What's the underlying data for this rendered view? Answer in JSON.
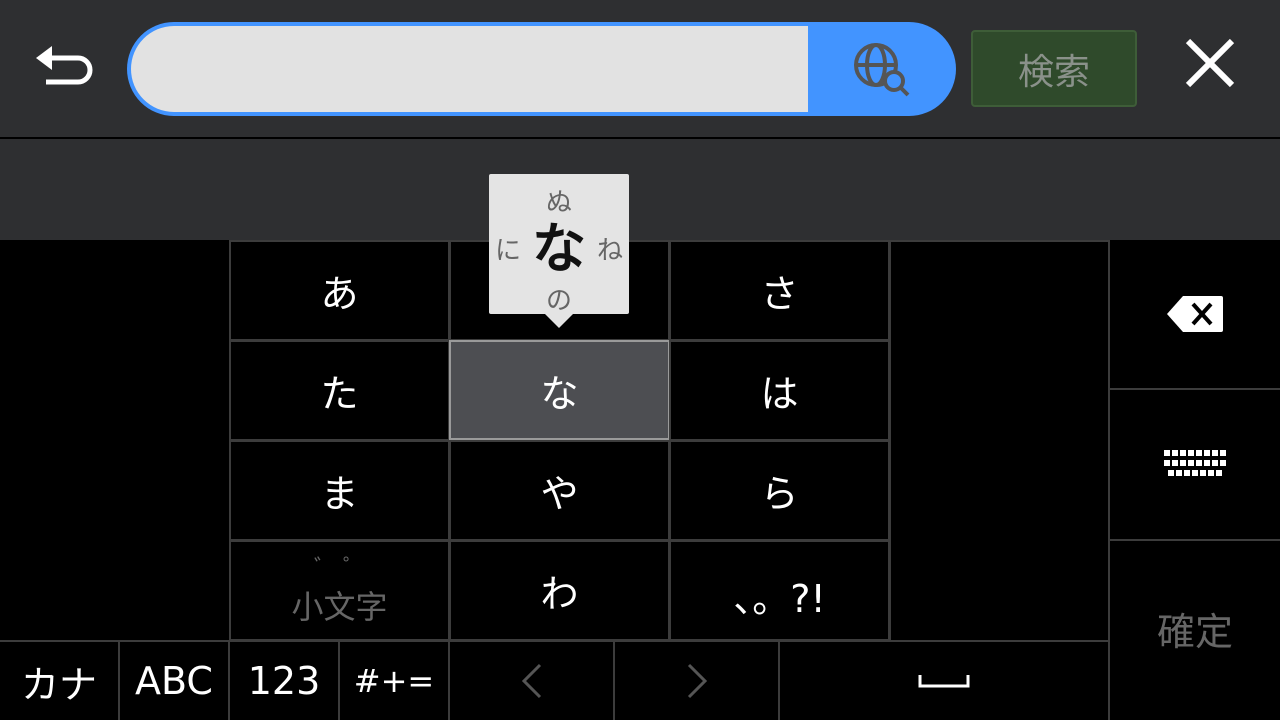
{
  "toolbar": {
    "back_icon": "undo-arrow-icon",
    "search_placeholder": "",
    "web_search_icon": "globe-search-icon",
    "search_label": "検索",
    "close_icon": "close-x-icon",
    "search_button_color": "#2f4a2b",
    "accent": "#4294ff"
  },
  "flick_popup": {
    "center": "な",
    "up": "ぬ",
    "left": "に",
    "right": "ね",
    "down": "の"
  },
  "keys": {
    "r1": [
      "あ",
      "",
      "さ"
    ],
    "r2": [
      "た",
      "な",
      "は"
    ],
    "r3": [
      "ま",
      "や",
      "ら"
    ],
    "r4": [
      "小文字",
      "わ",
      "、。?!"
    ],
    "modifier_marks": "゛ ゜"
  },
  "side": {
    "backspace_icon": "backspace-icon",
    "keyboard_icon": "keyboard-icon",
    "confirm_label": "確定"
  },
  "bottom": {
    "kana": "カナ",
    "abc": "ABC",
    "num": "123",
    "sym": "#+=",
    "left_label": "<",
    "right_label": ">",
    "space_icon": "space-icon"
  }
}
